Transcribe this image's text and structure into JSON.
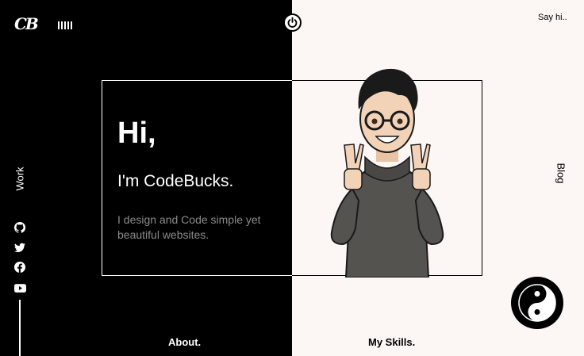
{
  "header": {
    "logo_text": "CB",
    "say_hi": "Say hi.."
  },
  "nav": {
    "work": "Work",
    "blog": "Blog",
    "about": "About.",
    "skills": "My Skills."
  },
  "intro": {
    "greeting": "Hi,",
    "name": "I'm CodeBucks.",
    "description": "I design and Code simple yet beautiful websites."
  },
  "social_icons": [
    "github-icon",
    "twitter-icon",
    "facebook-icon",
    "youtube-icon"
  ],
  "colors": {
    "dark": "#000000",
    "light": "#fcf6f4",
    "muted_text": "#8a8a8a"
  }
}
